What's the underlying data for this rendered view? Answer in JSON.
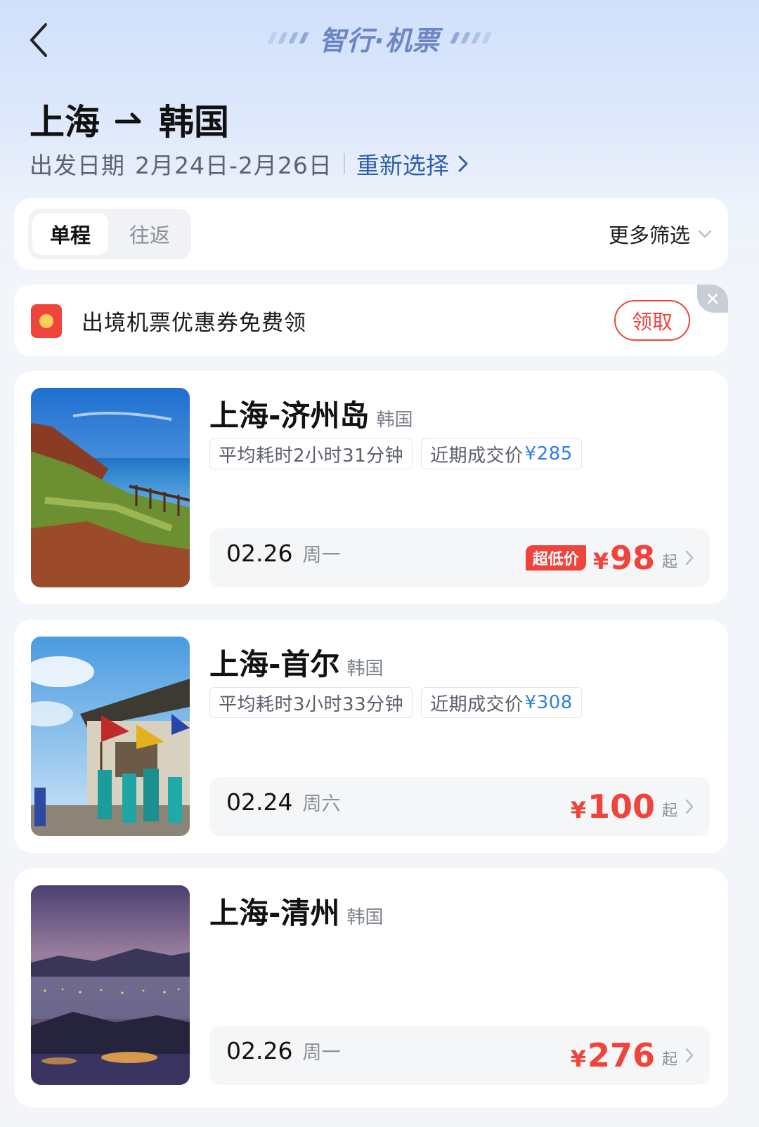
{
  "header": {
    "brand": "智行·机票",
    "origin": "上海",
    "destination": "韩国",
    "date_label": "出发日期",
    "date_range": "2月24日-2月26日",
    "reselect": "重新选择"
  },
  "filter": {
    "trip_types": [
      "单程",
      "往返"
    ],
    "selected_trip_type": "单程",
    "more_filter": "更多筛选"
  },
  "coupon": {
    "text": "出境机票优惠券免费领",
    "button": "领取"
  },
  "routes": [
    {
      "city": "上海-济州岛",
      "country": "韩国",
      "duration": "平均耗时2小时31分钟",
      "recent_label": "近期成交价",
      "recent_price": "¥285",
      "date": "02.26",
      "weekday": "周一",
      "badge": "超低价",
      "currency": "¥",
      "price": "98",
      "suffix": "起"
    },
    {
      "city": "上海-首尔",
      "country": "韩国",
      "duration": "平均耗时3小时33分钟",
      "recent_label": "近期成交价",
      "recent_price": "¥308",
      "date": "02.24",
      "weekday": "周六",
      "currency": "¥",
      "price": "100",
      "suffix": "起"
    },
    {
      "city": "上海-清州",
      "country": "韩国",
      "date": "02.26",
      "weekday": "周一",
      "currency": "¥",
      "price": "276",
      "suffix": "起"
    }
  ],
  "colors": {
    "accent_red": "#f0433c",
    "link_blue": "#2f5fa8",
    "price_blue": "#2d7fe0",
    "brand_blue": "#6d86c3"
  },
  "icons": [
    "back-arrow-icon",
    "arrow-right-icon",
    "chevron-right-icon",
    "chevron-down-icon",
    "red-envelope-icon",
    "close-icon"
  ]
}
